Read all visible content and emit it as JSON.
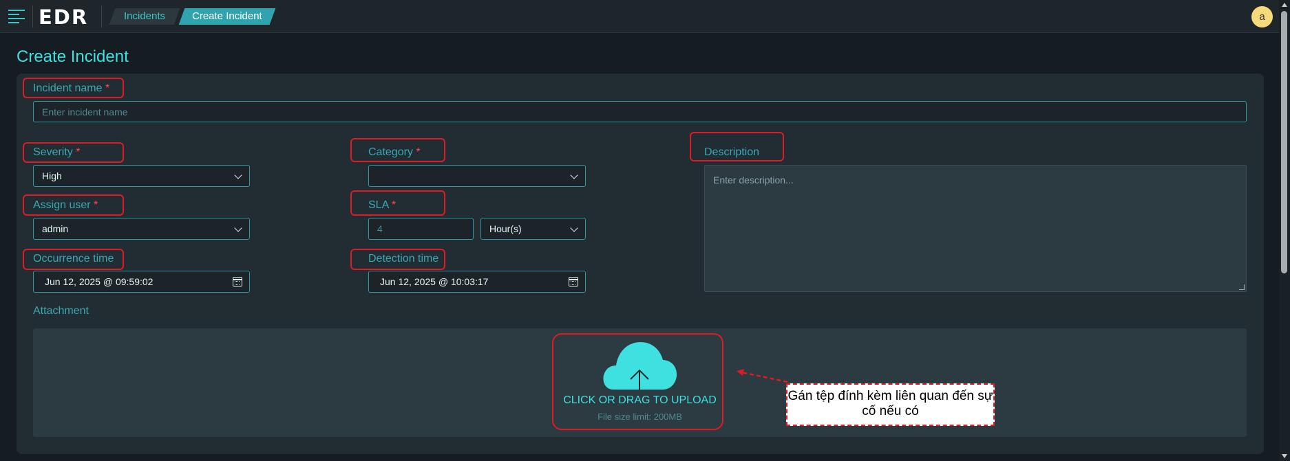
{
  "header": {
    "logo": "EDR",
    "breadcrumbs": [
      "Incidents",
      "Create Incident"
    ],
    "user_initial": "a"
  },
  "page": {
    "title": "Create Incident"
  },
  "form": {
    "incident_name": {
      "label": "Incident name",
      "required": "*",
      "placeholder": "Enter incident name"
    },
    "severity": {
      "label": "Severity",
      "required": "*",
      "value": "High"
    },
    "category": {
      "label": "Category",
      "required": "*",
      "value": ""
    },
    "description": {
      "label": "Description",
      "placeholder": "Enter description..."
    },
    "assign_user": {
      "label": "Assign user",
      "required": "*",
      "value": "admin"
    },
    "sla": {
      "label": "SLA",
      "required": "*",
      "value": "4",
      "unit": "Hour(s)"
    },
    "occurrence_time": {
      "label": "Occurrence time",
      "value": "Jun 12, 2025 @ 09:59:02"
    },
    "detection_time": {
      "label": "Detection time",
      "value": "Jun 12, 2025 @ 10:03:17"
    },
    "attachment": {
      "label": "Attachment",
      "upload_text": "CLICK OR DRAG TO UPLOAD",
      "size_limit": "File size limit: 200MB"
    }
  },
  "annotation": {
    "note": "Gán tệp đính kèm liên quan đến sự cố nếu có"
  },
  "colors": {
    "accent": "#3ec7c7",
    "background": "#161d22",
    "card": "#222c33",
    "callout": "#e01b24"
  }
}
